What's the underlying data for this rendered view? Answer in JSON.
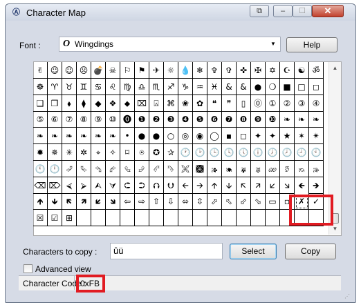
{
  "window": {
    "title": "Character Map",
    "minimize_label": "–",
    "maximize_label": "☐",
    "close_label": "✕",
    "restore_label": "⧉"
  },
  "font": {
    "label": "Font :",
    "value": "Wingdings",
    "help_label": "Help"
  },
  "grid": {
    "columns": 20,
    "selected_char": "û",
    "rows": [
      [
        "✌",
        "☺",
        "☺",
        "☹",
        "💣",
        "☠",
        "⚐",
        "⚑",
        "✈",
        "☼",
        "💧",
        "❄",
        "✞",
        "✞",
        "✜",
        "✠",
        "✡",
        "☪",
        "☯",
        "ॐ"
      ],
      [
        "☸",
        "♈",
        "♉",
        "♊",
        "♋",
        "♌",
        "♍",
        "♎",
        "♏",
        "♐",
        "♑",
        "♒",
        "♓",
        "&",
        "&",
        "●",
        "❍",
        "■",
        "□",
        "◻"
      ],
      [
        "❑",
        "❒",
        "⬧",
        "⧫",
        "◆",
        "❖",
        "⬥",
        "⌧",
        "⍓",
        "⌘",
        "❀",
        "✿",
        "❝",
        "❞",
        "▯",
        "⓪",
        "①",
        "②",
        "③",
        "④"
      ],
      [
        "⑤",
        "⑥",
        "⑦",
        "⑧",
        "⑨",
        "⑩",
        "⓿",
        "❶",
        "❷",
        "❸",
        "❹",
        "❺",
        "❻",
        "❼",
        "❽",
        "❾",
        "❿",
        "❧",
        "❧",
        "❧"
      ],
      [
        "❧",
        "❧",
        "❧",
        "❧",
        "❧",
        "❧",
        "•",
        "●",
        "●",
        "○",
        "◎",
        "◉",
        "◯",
        "▪",
        "◻",
        "✦",
        "✦",
        "★",
        "✶",
        "✴"
      ],
      [
        "✹",
        "✵",
        "✳",
        "✲",
        "⌖",
        "✧",
        "⌑",
        "⍟",
        "✪",
        "✰",
        "🕐",
        "🕑",
        "🕒",
        "🕓",
        "🕔",
        "🕕",
        "🕖",
        "🕗",
        "🕘",
        "🕙"
      ],
      [
        "🕚",
        "🕛",
        "⮰",
        "⮱",
        "⮲",
        "⮳",
        "⮴",
        "⮵",
        "⮶",
        "⮷",
        "🙪",
        "🙫",
        "🙕",
        "🙔",
        "🙗",
        "🙖",
        "🙐",
        "🙑",
        "🙒",
        "🙓"
      ],
      [
        "⌫",
        "⌦",
        "⮘",
        "⮚",
        "⮙",
        "⮛",
        "⮈",
        "⮊",
        "⮉",
        "⮋",
        "🡨",
        "🡪",
        "🡩",
        "🡫",
        "🡬",
        "🡭",
        "🡯",
        "🡮",
        "🡸",
        "🡺"
      ],
      [
        "🡹",
        "🡻",
        "🡼",
        "🡽",
        "🡿",
        "🡾",
        "⇦",
        "⇨",
        "⇧",
        "⇩",
        "⬄",
        "⇳",
        "⬀",
        "⬁",
        "⬃",
        "⬂",
        "▭",
        "▫",
        "✗",
        "✓"
      ],
      [
        "☒",
        "☑",
        "⊞",
        "",
        "",
        "",
        "",
        "",
        "",
        "",
        "",
        "",
        "",
        "",
        "",
        "",
        "",
        "",
        "",
        ""
      ]
    ]
  },
  "copy": {
    "label": "Characters to copy :",
    "value": "ûü",
    "select_label": "Select",
    "copy_label": "Copy"
  },
  "advanced": {
    "label": "Advanced view"
  },
  "status": {
    "label": "Character Code :",
    "value": "0xFB"
  },
  "highlight_color": "#e11b22"
}
